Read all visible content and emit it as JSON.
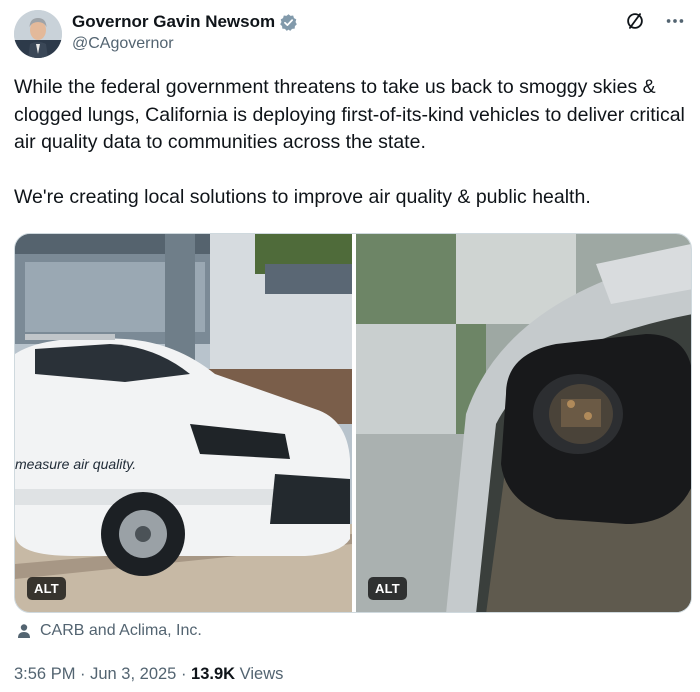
{
  "author": {
    "display_name": "Governor Gavin Newsom",
    "handle": "@CAgovernor",
    "verified": true,
    "verified_badge_color": "#829aab"
  },
  "tweet": {
    "text": "While the federal government threatens to take us back to smoggy skies & clogged lungs, California is deploying first-of-its-kind vehicles to deliver critical air quality data to communities across the state.\n\nWe're creating local solutions to improve air quality & public health."
  },
  "media": [
    {
      "alt_badge": "ALT",
      "car_decal_text": "measure air quality."
    },
    {
      "alt_badge": "ALT"
    }
  ],
  "credit": {
    "text": "CARB and Aclima, Inc."
  },
  "meta": {
    "time": "3:56 PM",
    "separator": " · ",
    "date": "Jun 3, 2025",
    "views_count": "13.9K",
    "views_label": " Views"
  },
  "icons": {
    "more": "slash-circle-icon",
    "menu": "more-dots-icon",
    "credit": "person-icon"
  },
  "colors": {
    "text_primary": "#0f1419",
    "text_secondary": "#536471",
    "border": "#cfd9de"
  }
}
